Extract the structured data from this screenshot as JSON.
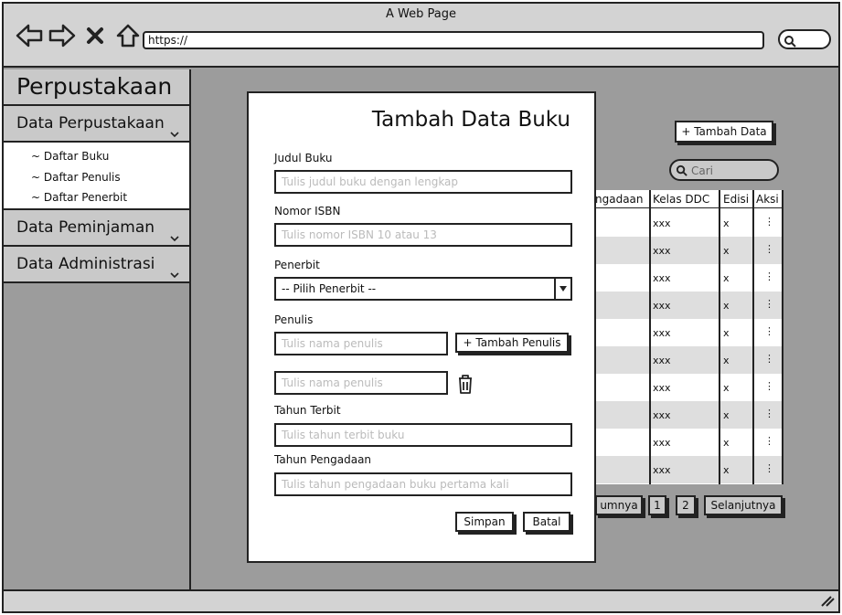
{
  "window": {
    "title": "A Web Page",
    "url": "https://"
  },
  "sidebar": {
    "app_title": "Perpustakaan",
    "sections": [
      {
        "label": "Data Perpustakaan"
      },
      {
        "label": "Data Peminjaman"
      },
      {
        "label": "Data Administrasi"
      }
    ],
    "sub_items": [
      "~ Daftar Buku",
      "~ Daftar Penulis",
      "~ Daftar Penerbit"
    ]
  },
  "page": {
    "add_button": "+ Tambah Data",
    "search_placeholder": "Cari",
    "columns": [
      "ngadaan",
      "Kelas DDC",
      "Edisi",
      "Aksi"
    ],
    "rows": [
      {
        "kelas": "xxx",
        "edisi": "x",
        "aksi": "⋮"
      },
      {
        "kelas": "xxx",
        "edisi": "x",
        "aksi": "⋮"
      },
      {
        "kelas": "xxx",
        "edisi": "x",
        "aksi": "⋮"
      },
      {
        "kelas": "xxx",
        "edisi": "x",
        "aksi": "⋮"
      },
      {
        "kelas": "xxx",
        "edisi": "x",
        "aksi": "⋮"
      },
      {
        "kelas": "xxx",
        "edisi": "x",
        "aksi": "⋮"
      },
      {
        "kelas": "xxx",
        "edisi": "x",
        "aksi": "⋮"
      },
      {
        "kelas": "xxx",
        "edisi": "x",
        "aksi": "⋮"
      },
      {
        "kelas": "xxx",
        "edisi": "x",
        "aksi": "⋮"
      },
      {
        "kelas": "xxx",
        "edisi": "x",
        "aksi": "⋮"
      }
    ],
    "pagination": {
      "prev": "umnya",
      "pages": [
        "1",
        "2"
      ],
      "next": "Selanjutnya"
    }
  },
  "modal": {
    "title": "Tambah Data Buku",
    "judul": {
      "label": "Judul Buku",
      "placeholder": "Tulis judul buku dengan lengkap"
    },
    "isbn": {
      "label": "Nomor ISBN",
      "placeholder": "Tulis nomor ISBN 10 atau 13"
    },
    "penerbit": {
      "label": "Penerbit",
      "value": "-- Pilih Penerbit --"
    },
    "penulis": {
      "label": "Penulis",
      "placeholder": "Tulis nama penulis",
      "add_label": "+ Tambah Penulis"
    },
    "tahun_terbit": {
      "label": "Tahun Terbit",
      "placeholder": "Tulis tahun terbit buku"
    },
    "tahun_pengadaan": {
      "label": "Tahun Pengadaan",
      "placeholder": "Tulis tahun pengadaan buku pertama kali"
    },
    "save_label": "Simpan",
    "cancel_label": "Batal"
  }
}
